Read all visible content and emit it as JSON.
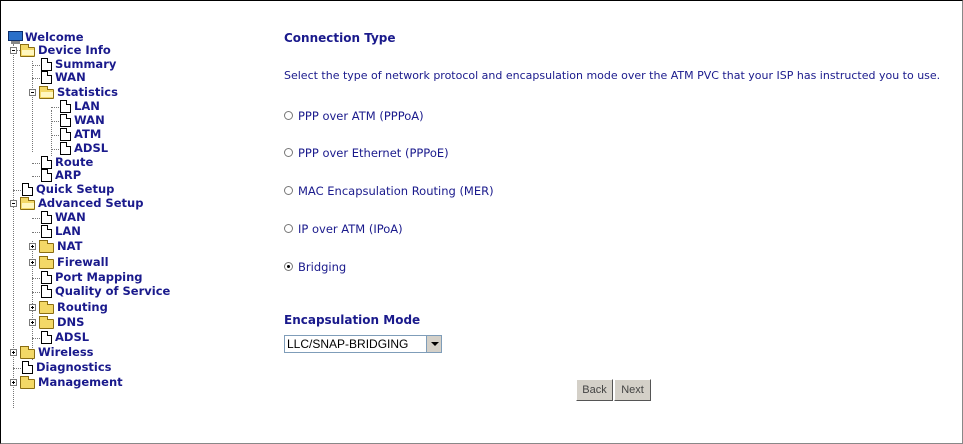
{
  "nav": {
    "welcome": "Welcome",
    "device_info": "Device Info",
    "summary": "Summary",
    "wan": "WAN",
    "statistics": "Statistics",
    "stats_lan": "LAN",
    "stats_wan": "WAN",
    "stats_atm": "ATM",
    "stats_adsl": "ADSL",
    "route": "Route",
    "arp": "ARP",
    "quick_setup": "Quick Setup",
    "advanced_setup": "Advanced Setup",
    "adv_wan": "WAN",
    "adv_lan": "LAN",
    "nat": "NAT",
    "firewall": "Firewall",
    "port_mapping": "Port Mapping",
    "qos": "Quality of Service",
    "routing": "Routing",
    "dns": "DNS",
    "adv_adsl": "ADSL",
    "wireless": "Wireless",
    "diagnostics": "Diagnostics",
    "management": "Management"
  },
  "main": {
    "title": "Connection Type",
    "description": "Select the type of network protocol and encapsulation mode over the ATM PVC that your ISP has instructed you to use.",
    "options": [
      {
        "label": "PPP over ATM (PPPoA)",
        "selected": false
      },
      {
        "label": "PPP over Ethernet (PPPoE)",
        "selected": false
      },
      {
        "label": "MAC Encapsulation Routing (MER)",
        "selected": false
      },
      {
        "label": "IP over ATM (IPoA)",
        "selected": false
      },
      {
        "label": "Bridging",
        "selected": true
      }
    ],
    "encap_title": "Encapsulation Mode",
    "encap_value": "LLC/SNAP-BRIDGING",
    "back_label": "Back",
    "next_label": "Next"
  },
  "icons": {
    "welcome": "computer-icon",
    "folder": "folder-icon",
    "page": "page-icon",
    "expand": "plus-box-icon",
    "collapse": "minus-box-icon"
  },
  "colors": {
    "link_text": "#1a1a8c",
    "folder": "#f3d867",
    "button": "#d4d0c8"
  }
}
